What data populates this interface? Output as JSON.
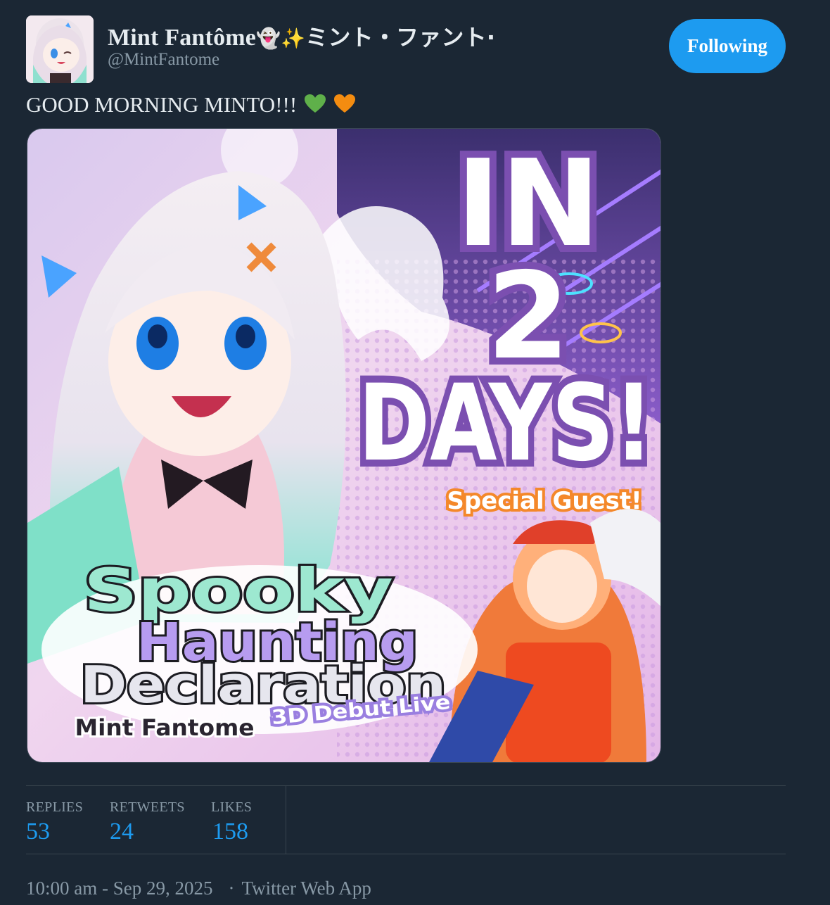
{
  "author": {
    "display_name": "Mint Fantôme",
    "display_name_emoji": "👻✨",
    "display_name_jp": "ミント・ファント·",
    "handle": "@MintFantome",
    "avatar_icon": "avatar-image"
  },
  "follow_button": {
    "label": "Following",
    "color": "#1d9bf0"
  },
  "tweet": {
    "text": "GOOD MORNING MINTO!!!",
    "emojis": [
      "green-heart",
      "orange-heart"
    ]
  },
  "media": {
    "headline_line1": "IN",
    "headline_line2": "2",
    "headline_line3": "DAYS!",
    "special_guest": "Special Guest!",
    "title_line1": "Spooky",
    "title_line2": "Haunting",
    "title_line3": "Declaration",
    "subtitle_name": "Mint Fantome",
    "subtitle_event": "3D Debut Live"
  },
  "stats": {
    "replies_label": "REPLIES",
    "replies_value": "53",
    "retweets_label": "RETWEETS",
    "retweets_value": "24",
    "likes_label": "LIKES",
    "likes_value": "158"
  },
  "meta": {
    "timestamp": "10:00 am - Sep 29, 2025",
    "separator": "·",
    "source": "Twitter Web App"
  },
  "colors": {
    "background": "#1b2734",
    "accent": "#1d9bf0",
    "muted": "#8899a6",
    "text": "#e6ecf0",
    "headline_purple": "#7b4fb0"
  }
}
